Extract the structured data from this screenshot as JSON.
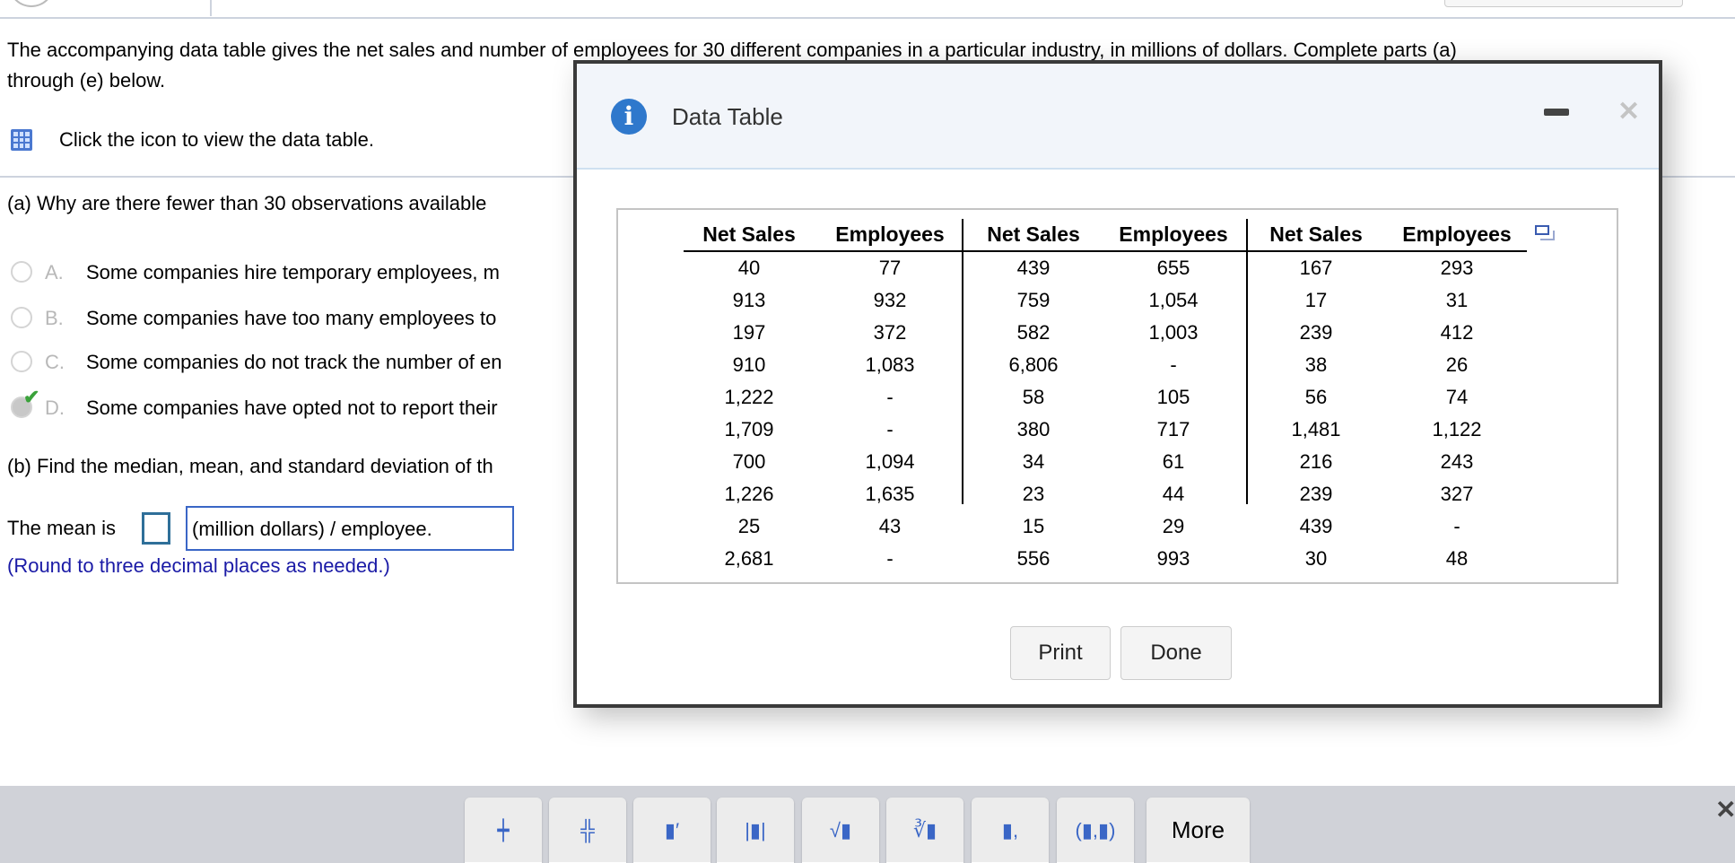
{
  "intro": {
    "line1": "The accompanying data table gives the net sales and number of employees for 30 different companies in a particular industry, in millions of dollars. Complete parts (a)",
    "line2": "through (e) below.",
    "icon_hint": "Click the icon to view the data table."
  },
  "part_a": {
    "question": "(a) Why are there fewer than 30 observations available",
    "options": [
      {
        "letter": "A.",
        "text": "Some companies hire temporary employees, m",
        "selected": false
      },
      {
        "letter": "B.",
        "text": "Some companies have too many employees to",
        "selected": false
      },
      {
        "letter": "C.",
        "text": "Some companies do not track the number of en",
        "selected": false
      },
      {
        "letter": "D.",
        "text": "Some companies have opted not to report their",
        "selected": true
      }
    ]
  },
  "part_b": {
    "question": "(b) Find the median, mean, and standard deviation of th",
    "mean_prefix": "The mean is",
    "mean_value": "",
    "unit": "(million dollars) / employee.",
    "hint": "(Round to three decimal places as needed.)"
  },
  "dialog": {
    "title": "Data Table",
    "headers": [
      "Net Sales",
      "Employees",
      "Net Sales",
      "Employees",
      "Net Sales",
      "Employees"
    ],
    "rows": [
      [
        "40",
        "77",
        "439",
        "655",
        "167",
        "293"
      ],
      [
        "913",
        "932",
        "759",
        "1,054",
        "17",
        "31"
      ],
      [
        "197",
        "372",
        "582",
        "1,003",
        "239",
        "412"
      ],
      [
        "910",
        "1,083",
        "6,806",
        "-",
        "38",
        "26"
      ],
      [
        "1,222",
        "-",
        "58",
        "105",
        "56",
        "74"
      ],
      [
        "1,709",
        "-",
        "380",
        "717",
        "1,481",
        "1,122"
      ],
      [
        "700",
        "1,094",
        "34",
        "61",
        "216",
        "243"
      ],
      [
        "1,226",
        "1,635",
        "23",
        "44",
        "239",
        "327"
      ],
      [
        "25",
        "43",
        "15",
        "29",
        "439",
        "-"
      ],
      [
        "2,681",
        "-",
        "556",
        "993",
        "30",
        "48"
      ]
    ],
    "print_label": "Print",
    "done_label": "Done"
  },
  "toolbar": {
    "more_label": "More",
    "tools": [
      "fraction-icon",
      "mixed-number-icon",
      "exponent-icon",
      "absolute-value-icon",
      "square-root-icon",
      "nth-root-icon",
      "subscript-icon",
      "ordered-pair-icon"
    ]
  },
  "colors": {
    "accent": "#3a66c6",
    "hint": "#1a1aa6",
    "check": "#3aa23a"
  }
}
